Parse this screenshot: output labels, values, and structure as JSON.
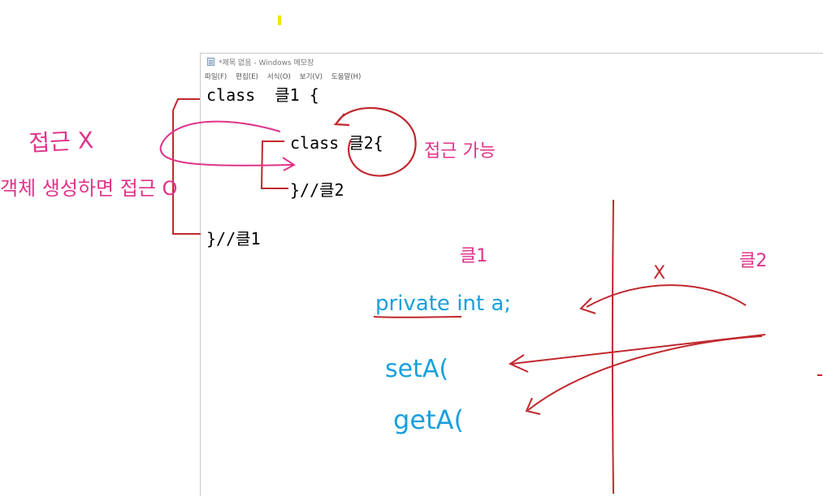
{
  "colors": {
    "pen_pink": "#e0338a",
    "pen_red": "#c0282e",
    "pen_blue": "#1aa0dc",
    "cursor_yellow": "#f2e600"
  },
  "window": {
    "title": "*제목 없음 - Windows 메모장",
    "icon": "notepad-icon",
    "menu": [
      "파일(F)",
      "편집(E)",
      "서식(O)",
      "보기(V)",
      "도움말(H)"
    ]
  },
  "code": {
    "line1": "class  클1 {",
    "line2": "class 클2{",
    "line3": "}//클2",
    "line4": "}//클1"
  },
  "annotations": {
    "no_access": "접근 X",
    "object_access": "객체 생성하면 접근 O",
    "access_ok": "접근 가능",
    "class1": "클1",
    "class2": "클2",
    "x_mark": "X",
    "private_field": "private int a;",
    "setter": "setA(",
    "getter": "getA("
  }
}
